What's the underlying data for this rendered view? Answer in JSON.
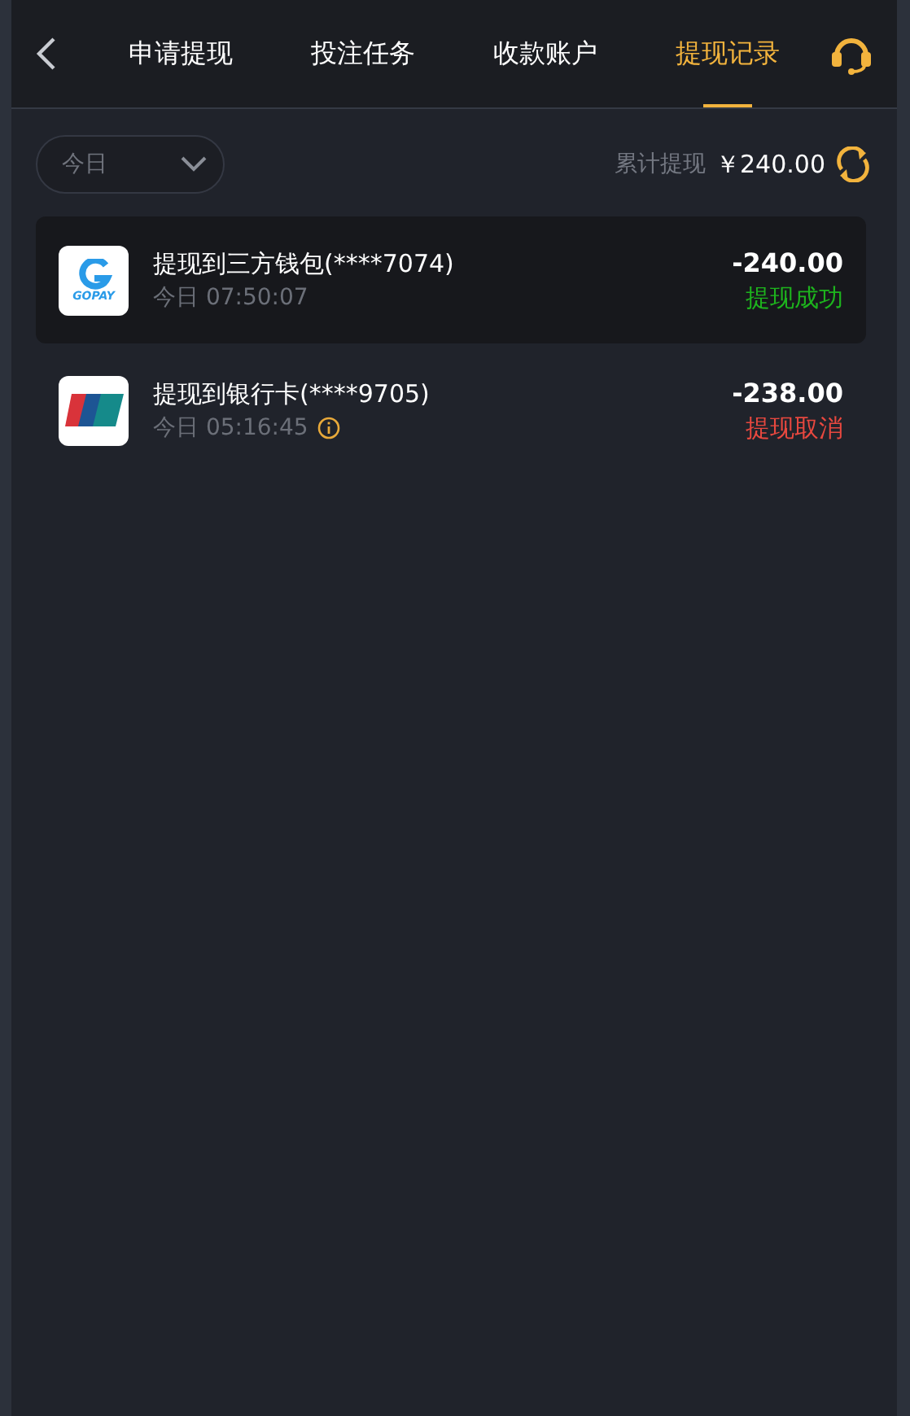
{
  "tabs": [
    {
      "label": "申请提现",
      "selected": false
    },
    {
      "label": "投注任务",
      "selected": false
    },
    {
      "label": "收款账户",
      "selected": false
    },
    {
      "label": "提现记录",
      "selected": true
    }
  ],
  "filter": {
    "value": "今日"
  },
  "summary": {
    "label": "累计提现",
    "amount": "￥240.00"
  },
  "records": [
    {
      "kind": "gopay",
      "logo_text": "GOPAY",
      "title": "提现到三方钱包(****7074)",
      "time": "今日 07:50:07",
      "info": false,
      "amount": "-240.00",
      "status": "提现成功",
      "color": "#1db31d",
      "selected": true
    },
    {
      "kind": "unionpay",
      "title": "提现到银行卡(****9705)",
      "time": "今日 05:16:45",
      "info": true,
      "amount": "-238.00",
      "status": "提现取消",
      "color": "#e8483f",
      "selected": false
    }
  ]
}
